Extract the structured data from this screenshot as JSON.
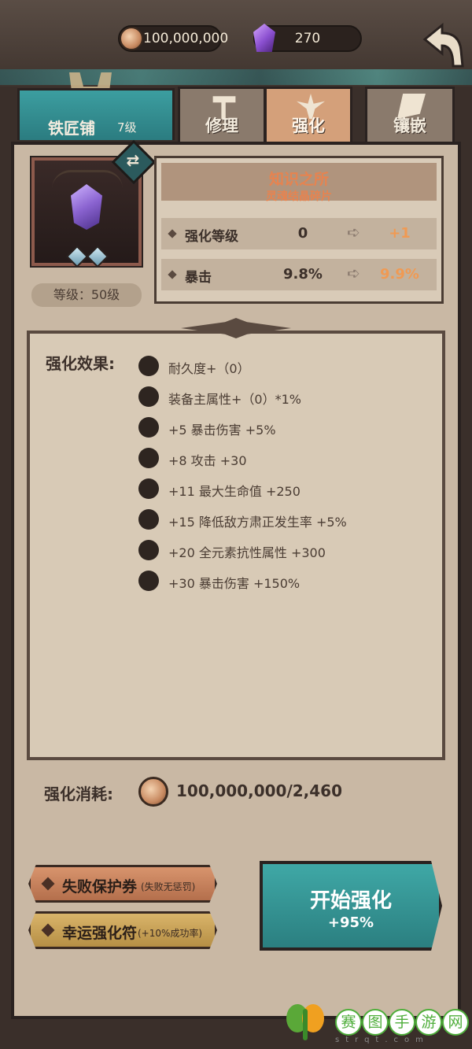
{
  "resources": {
    "coins": "100,000,000",
    "gems": "270"
  },
  "shop": {
    "name": "铁匠铺",
    "level": "7级"
  },
  "tabs": [
    {
      "label": "修理",
      "active": false
    },
    {
      "label": "强化",
      "active": true
    },
    {
      "label": "镶嵌",
      "active": false
    }
  ],
  "item": {
    "name": "知识之所",
    "subtitle": "灵魂结晶碎片",
    "level": "等级：50级"
  },
  "stats": [
    {
      "name": "强化等级",
      "current": "0",
      "next": "+1"
    },
    {
      "name": "暴击",
      "current": "9.8%",
      "next": "9.9%"
    }
  ],
  "effects": {
    "title": "强化效果:",
    "items": [
      "耐久度+（0）",
      "装备主属性+（0）*1%",
      "+5  暴击伤害 +5%",
      "+8  攻击 +30",
      "+11  最大生命值 +250",
      "+15  降低敌方肃正发生率 +5%",
      "+20  全元素抗性属性 +300",
      "+30  暴击伤害 +150%"
    ]
  },
  "cost": {
    "label": "强化消耗:",
    "value": "100,000,000/2,460"
  },
  "options": {
    "protect_label": "失败保护券",
    "protect_note": "(失败无惩罚)",
    "luck_label": "幸运强化符",
    "luck_note": "(+10%成功率)"
  },
  "start": {
    "label": "开始强化",
    "rate": "+95%"
  },
  "watermark": {
    "chars": [
      "赛",
      "图",
      "手",
      "游",
      "网"
    ],
    "sub": "strqt.com"
  },
  "colors": {
    "accent_teal": "#3fa8a6",
    "highlight_orange": "#f09a53",
    "panel_bg": "#c9b8a4"
  }
}
